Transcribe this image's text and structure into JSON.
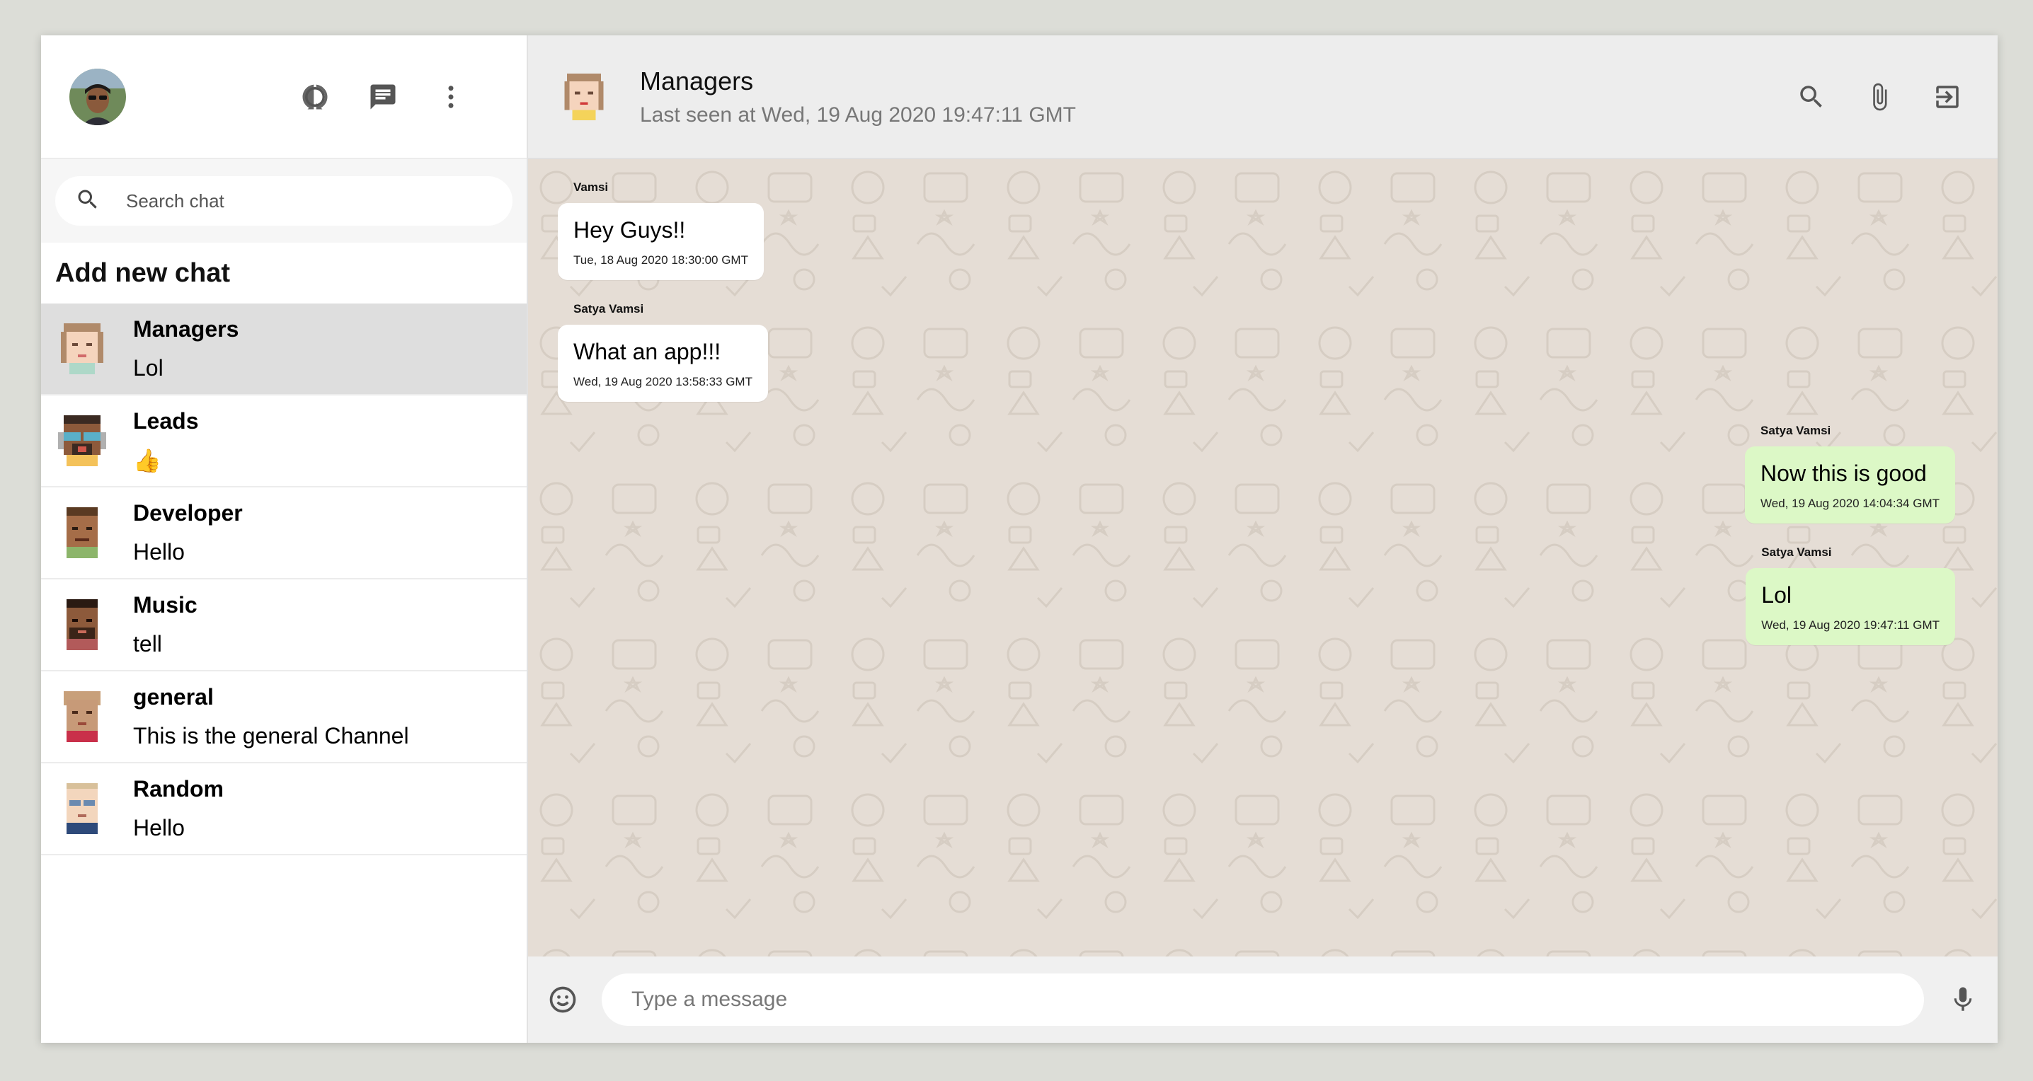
{
  "colors": {
    "sent_bubble": "#dcf8c6",
    "received_bubble": "#ffffff",
    "chat_bg": "#e5ddd5",
    "active_chat": "#dedede"
  },
  "sidebar": {
    "icons": [
      "status-icon",
      "new-chat-icon",
      "more-vert-icon"
    ],
    "search_placeholder": "Search chat",
    "add_new_chat": "Add new chat",
    "chats": [
      {
        "name": "Managers",
        "last": "Lol"
      },
      {
        "name": "Leads",
        "last": "👍"
      },
      {
        "name": "Developer",
        "last": "Hello"
      },
      {
        "name": "Music",
        "last": "tell"
      },
      {
        "name": "general",
        "last": "This is the general Channel"
      },
      {
        "name": "Random",
        "last": "Hello"
      }
    ]
  },
  "header": {
    "title": "Managers",
    "last_seen": "Last seen at Wed, 19 Aug 2020 19:47:11 GMT",
    "icons": [
      "search-icon",
      "attach-icon",
      "logout-icon"
    ]
  },
  "messages": [
    {
      "sender": "Vamsi",
      "text": "Hey Guys!!",
      "time": "Tue, 18 Aug 2020 18:30:00 GMT",
      "mine": false
    },
    {
      "sender": "Satya Vamsi",
      "text": "What an app!!!",
      "time": "Wed, 19 Aug 2020 13:58:33 GMT",
      "mine": false
    },
    {
      "sender": "Satya Vamsi",
      "text": "Now this is good",
      "time": "Wed, 19 Aug 2020 14:04:34 GMT",
      "mine": true
    },
    {
      "sender": "Satya Vamsi",
      "text": "Lol",
      "time": "Wed, 19 Aug 2020 19:47:11 GMT",
      "mine": true
    }
  ],
  "composer": {
    "placeholder": "Type a message",
    "icons": [
      "emoji-icon",
      "mic-icon"
    ]
  }
}
